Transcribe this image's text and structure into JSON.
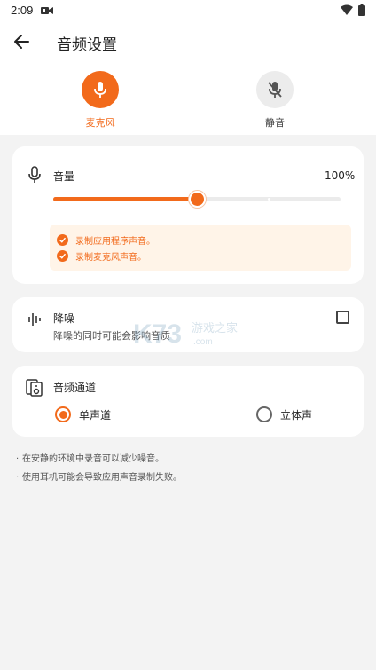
{
  "status_bar": {
    "time": "2:09"
  },
  "app_bar": {
    "title": "音频设置"
  },
  "modes": [
    {
      "label": "麦克风",
      "selected": true,
      "icon": "mic-icon"
    },
    {
      "label": "静音",
      "selected": false,
      "icon": "mic-off-icon"
    }
  ],
  "volume": {
    "label": "音量",
    "value_text": "100%",
    "slider_level": 0.5,
    "notices": [
      "录制应用程序声音。",
      "录制麦克风声音。"
    ]
  },
  "noise_reduction": {
    "label": "降噪",
    "description": "降噪的同时可能会影响音质",
    "checked": false
  },
  "channel": {
    "label": "音频通道",
    "options": [
      {
        "label": "单声道",
        "selected": true
      },
      {
        "label": "立体声",
        "selected": false
      }
    ]
  },
  "tips": [
    "在安静的环境中录音可以减少噪音。",
    "使用耳机可能会导致应用声音录制失败。"
  ],
  "watermark": {
    "brand": "K73",
    "cn": "游戏之家",
    "domain": ".com"
  },
  "colors": {
    "accent": "#f26a1b",
    "background": "#f3f3f3",
    "card": "#ffffff",
    "notice_bg": "#fff4e8"
  }
}
